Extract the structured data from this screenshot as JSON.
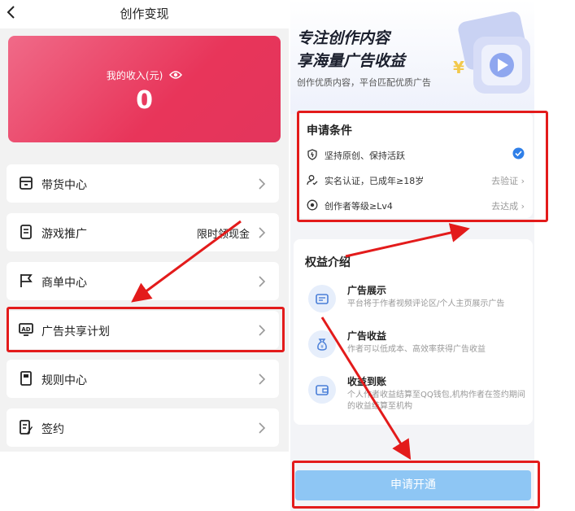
{
  "left": {
    "title": "创作变现",
    "income_label": "我的收入(元)",
    "income_value": "0",
    "menu": [
      {
        "label": "带货中心",
        "right": "",
        "icon": "store-icon"
      },
      {
        "label": "游戏推广",
        "right": "限时领现金",
        "icon": "document-icon"
      },
      {
        "label": "商单中心",
        "right": "",
        "icon": "flag-icon"
      },
      {
        "label": "广告共享计划",
        "right": "",
        "icon": "ad-icon"
      },
      {
        "label": "规则中心",
        "right": "",
        "icon": "rule-book-icon"
      },
      {
        "label": "签约",
        "right": "",
        "icon": "sign-contract-icon"
      }
    ]
  },
  "right": {
    "hero_line1": "专注创作内容",
    "hero_line2": "享海量广告收益",
    "hero_sub": "创作优质内容，平台匹配优质广告",
    "conditions_title": "申请条件",
    "conditions": [
      {
        "text": "坚持原创、保持活跃",
        "action": "",
        "icon": "shield-icon",
        "done": true
      },
      {
        "text": "实名认证，已成年≥18岁",
        "action": "去验证",
        "icon": "user-verify-icon",
        "done": false
      },
      {
        "text": "创作者等级≥Lv4",
        "action": "去达成",
        "icon": "level-icon",
        "done": false
      }
    ],
    "benefits_title": "权益介绍",
    "benefits": [
      {
        "title": "广告展示",
        "desc": "平台将于作者视频评论区/个人主页展示广告",
        "icon": "ad-display-icon"
      },
      {
        "title": "广告收益",
        "desc": "作者可以低成本、高效率获得广告收益",
        "icon": "money-bag-icon"
      },
      {
        "title": "收益到账",
        "desc": "个人作者收益结算至QQ钱包,机构作者在签约期间的收益结算至机构",
        "icon": "wallet-icon"
      }
    ],
    "apply_label": "申请开通"
  },
  "colors": {
    "income_card": "#e8355a",
    "apply_button": "#8ec6f4",
    "annotation_red": "#e31b1b",
    "check_blue": "#2f7fe8"
  }
}
